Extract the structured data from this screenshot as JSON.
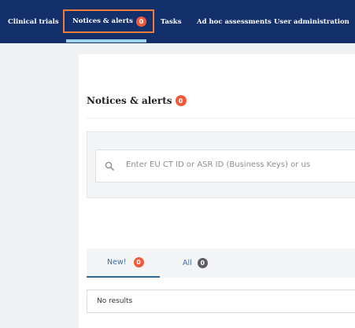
{
  "topnav": {
    "items": [
      {
        "label": "Clinical trials"
      },
      {
        "label": "Notices & alerts",
        "badge": "0"
      },
      {
        "label": "Tasks"
      },
      {
        "label": "Ad hoc assessments"
      },
      {
        "label": "User administration"
      }
    ]
  },
  "page": {
    "title": "Notices & alerts",
    "title_badge": "0"
  },
  "search": {
    "placeholder": "Enter EU CT ID or ASR ID (Business Keys) or us"
  },
  "tabs": [
    {
      "label": "New!",
      "badge": "0"
    },
    {
      "label": "All",
      "badge": "0"
    }
  ],
  "results": {
    "message": "No results"
  },
  "colors": {
    "nav_bg": "#13306b",
    "highlight_border": "#f07d3c",
    "badge_red": "#f05a3a",
    "badge_gray": "#5b5d61",
    "tab_text": "#3b6ea8"
  }
}
